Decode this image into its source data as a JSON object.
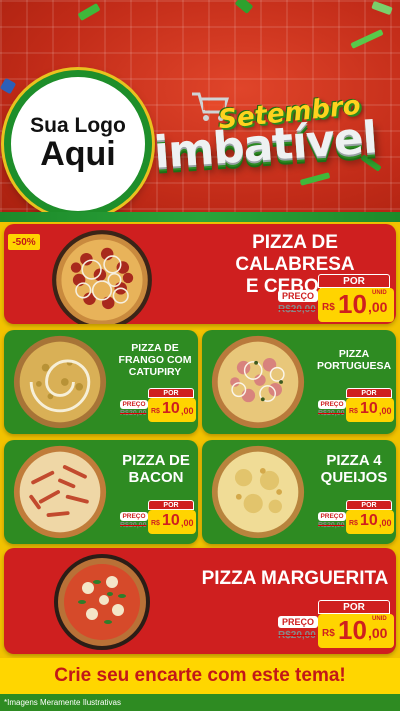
{
  "header": {
    "logo_line1": "Sua Logo",
    "logo_line2": "Aqui",
    "campaign_word1": "Setembro",
    "campaign_word2": "imbatível"
  },
  "badge": "-50%",
  "labels": {
    "por": "POR",
    "preco": "PREÇO",
    "currency": "R$",
    "unid": "UNID"
  },
  "products": [
    {
      "name_line1": "PIZZA DE CALABRESA",
      "name_line2": "E CEBOLA",
      "old_price": "R$20,00",
      "price_int": "10",
      "price_dec": ",00"
    },
    {
      "name_line1": "PIZZA DE",
      "name_line2": "FRANGO COM",
      "name_line3": "CATUPIRY",
      "old_price": "R$20,00",
      "price_int": "10",
      "price_dec": ",00"
    },
    {
      "name_line1": "PIZZA",
      "name_line2": "PORTUGUESA",
      "old_price": "R$20,00",
      "price_int": "10",
      "price_dec": ",00"
    },
    {
      "name_line1": "PIZZA DE",
      "name_line2": "BACON",
      "old_price": "R$20,00",
      "price_int": "10",
      "price_dec": ",00"
    },
    {
      "name_line1": "PIZZA 4",
      "name_line2": "QUEIJOS",
      "old_price": "R$20,00",
      "price_int": "10",
      "price_dec": ",00"
    },
    {
      "name_line1": "PIZZA MARGUERITA",
      "old_price": "R$20,00",
      "price_int": "10",
      "price_dec": ",00"
    }
  ],
  "footer": {
    "cta": "Crie seu encarte com este tema!",
    "disclaimer": "*Imagens Meramente Ilustrativas"
  },
  "colors": {
    "red": "#cf1f1f",
    "green": "#2e8b22",
    "yellow": "#ffd400"
  }
}
